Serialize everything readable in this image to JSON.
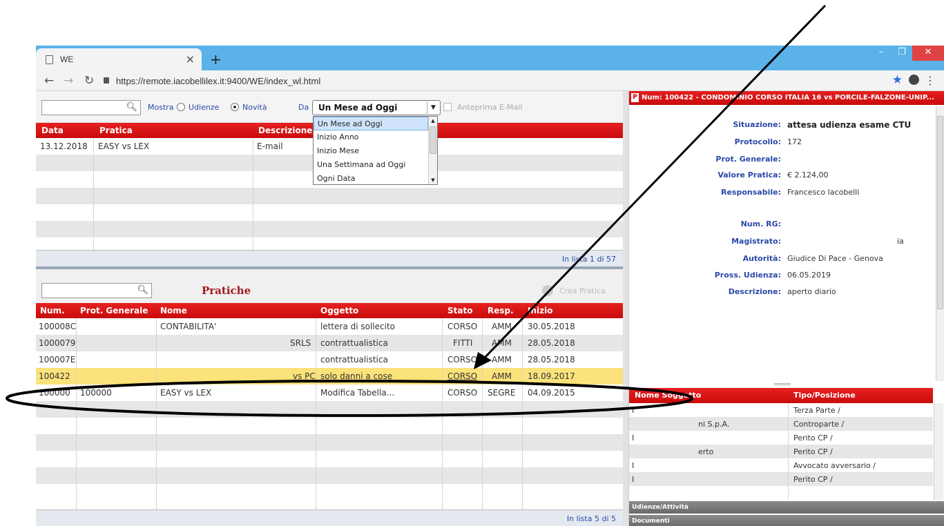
{
  "browser": {
    "tab_title": "WE",
    "url": "https://remote.iacobellilex.it:9400/WE/index_wl.html"
  },
  "toolbar": {
    "mostra": "Mostra",
    "udienze": "Udienze",
    "novita": "Novità",
    "da": "Da",
    "period_selected": "Un Mese ad Oggi",
    "period_options": [
      "Un Mese ad Oggi",
      "Inizio Anno",
      "Inizio Mese",
      "Una Settimana ad Oggi",
      "Ogni Data"
    ],
    "anteprima": "Anteprima E-Mail"
  },
  "news_grid": {
    "headers": [
      "Data",
      "Pratica",
      "Descrizione"
    ],
    "rows": [
      {
        "data": "13.12.2018",
        "pratica": "EASY vs LEX",
        "descrizione": "E-mail"
      }
    ],
    "footer": "In lista 1 di 57"
  },
  "pratiche": {
    "title": "Pratiche",
    "crea": "Crea Pratica",
    "headers": [
      "Num.",
      "Prot. Generale",
      "Nome",
      "Oggetto",
      "Stato",
      "Resp.",
      "Inizio"
    ],
    "rows": [
      {
        "num": "100008C",
        "prot": "",
        "nome": "CONTABILITA'",
        "oggetto": "lettera di sollecito",
        "stato": "CORSO",
        "resp": "AMM",
        "inizio": "30.05.2018"
      },
      {
        "num": "1000079",
        "prot": "",
        "nome": "SRLS",
        "oggetto": "contrattualistica",
        "stato": "FITTI",
        "resp": "AMM",
        "inizio": "28.05.2018"
      },
      {
        "num": "100007E",
        "prot": "",
        "nome": "",
        "oggetto": "contrattualistica",
        "stato": "CORSO",
        "resp": "AMM",
        "inizio": "28.05.2018"
      },
      {
        "num": "100422",
        "prot": "",
        "nome": "vs PC",
        "oggetto": "solo danni a cose",
        "stato": "CORSO",
        "resp": "AMM",
        "inizio": "18.09.2017"
      },
      {
        "num": "100000",
        "prot": "100000",
        "nome": "EASY vs LEX",
        "oggetto": "Modifica Tabella...",
        "stato": "CORSO",
        "resp": "SEGRE",
        "inizio": "04.09.2015"
      }
    ],
    "footer": "In lista 5 di 5"
  },
  "detail": {
    "title": "Num: 100422 - CONDOMINIO CORSO ITALIA 16 vs PORCILE-FALZONE-UNIP...",
    "badge": "P",
    "fields": [
      {
        "k": "Situazione:",
        "v": "attesa udienza esame CTU"
      },
      {
        "k": "Protocollo:",
        "v": "172"
      },
      {
        "k": "Prot. Generale:",
        "v": ""
      },
      {
        "k": "Valore Pratica:",
        "v": "€ 2.124,00"
      },
      {
        "k": "Responsabile:",
        "v": "Francesco Iacobelli"
      },
      {
        "k": "Num. RG:",
        "v": ""
      },
      {
        "k": "Magistrato:",
        "v": "ia"
      },
      {
        "k": "Autorità:",
        "v": "Giudice Di Pace - Genova"
      },
      {
        "k": "Pross. Udienza:",
        "v": "06.05.2019"
      },
      {
        "k": "Descrizione:",
        "v": "aperto diario"
      }
    ],
    "subjects_headers": [
      "Nome Soggetto",
      "Tipo/Posizione"
    ],
    "subjects": [
      {
        "nome": "I",
        "tipo": "Terza Parte /"
      },
      {
        "nome": "ni S.p.A.",
        "tipo": "Controparte /"
      },
      {
        "nome": "I",
        "tipo": "Perito CP /"
      },
      {
        "nome": "erto",
        "tipo": "Perito CP /"
      },
      {
        "nome": "I",
        "tipo": "Avvocato avversario /"
      },
      {
        "nome": "I",
        "tipo": "Perito CP /"
      }
    ],
    "accordion": [
      "Udienze/Attività",
      "Documenti"
    ]
  }
}
